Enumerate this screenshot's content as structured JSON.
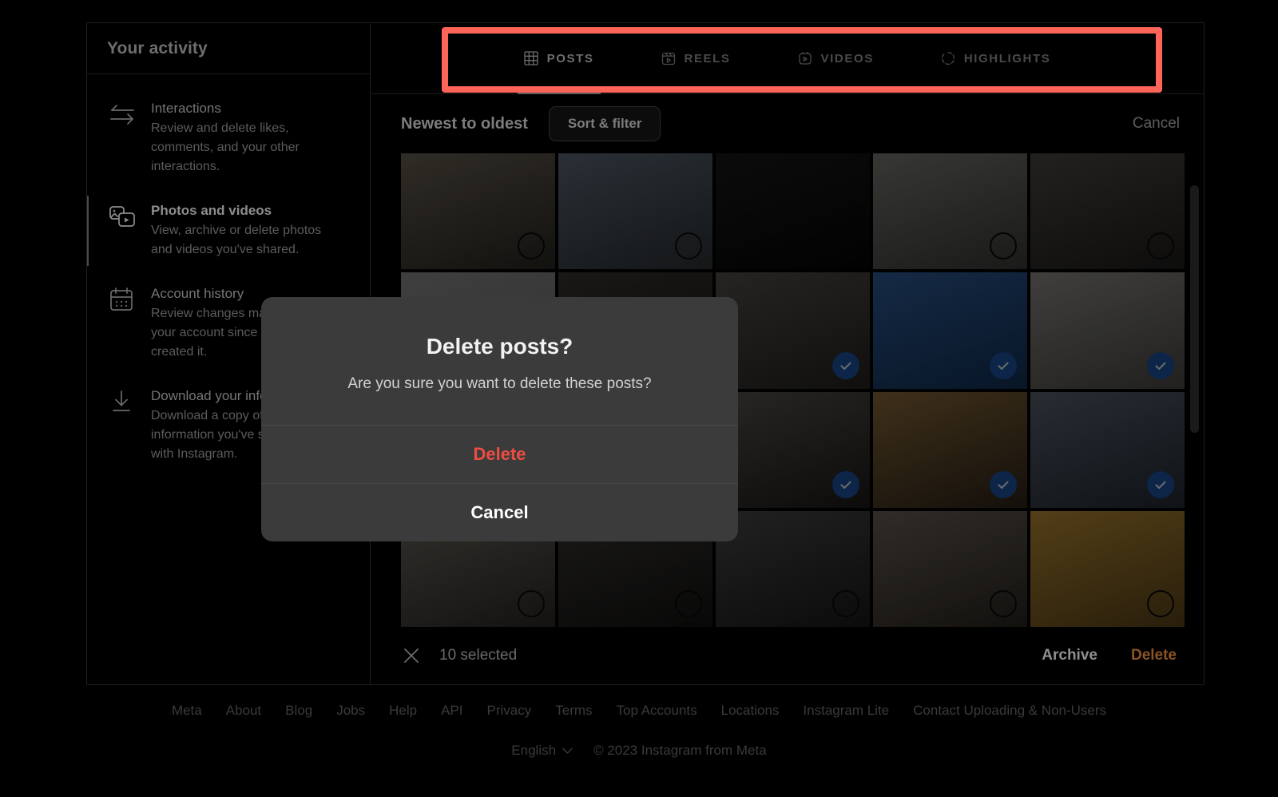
{
  "sidebar": {
    "title": "Your activity",
    "items": [
      {
        "icon": "interactions-arrows-icon",
        "label": "Interactions",
        "desc": "Review and delete likes, comments, and your other interactions.",
        "active": false
      },
      {
        "icon": "photos-videos-icon",
        "label": "Photos and videos",
        "desc": "View, archive or delete photos and videos you've shared.",
        "active": true
      },
      {
        "icon": "calendar-icon",
        "label": "Account history",
        "desc": "Review changes made to your account since you created it.",
        "active": false
      },
      {
        "icon": "download-icon",
        "label": "Download your information",
        "desc": "Download a copy of the information you've shared with Instagram.",
        "active": false
      }
    ]
  },
  "tabs": [
    {
      "label": "POSTS",
      "icon": "grid-icon",
      "active": true
    },
    {
      "label": "REELS",
      "icon": "reels-icon",
      "active": false
    },
    {
      "label": "VIDEOS",
      "icon": "video-icon",
      "active": false
    },
    {
      "label": "HIGHLIGHTS",
      "icon": "highlights-icon",
      "active": false
    }
  ],
  "toolbar": {
    "sort_label": "Newest to oldest",
    "sort_filter_label": "Sort & filter",
    "cancel_label": "Cancel"
  },
  "grid": {
    "tiles": [
      {
        "selected": false,
        "c1": "#6b6356",
        "c2": "#2a2722"
      },
      {
        "selected": false,
        "c1": "#5d6a78",
        "c2": "#2e3236"
      },
      {
        "selected": false,
        "c1": "#1a1a1a",
        "c2": "#050505"
      },
      {
        "selected": false,
        "c1": "#7a7a74",
        "c2": "#3a3a38"
      },
      {
        "selected": false,
        "c1": "#4e4a46",
        "c2": "#1f1d1b"
      },
      {
        "selected": false,
        "c1": "#8c8c8c",
        "c2": "#6d6d6d"
      },
      {
        "selected": false,
        "c1": "#3b3631",
        "c2": "#171512"
      },
      {
        "selected": true,
        "c1": "#55504a",
        "c2": "#252320"
      },
      {
        "selected": true,
        "c1": "#2f5d99",
        "c2": "#123055"
      },
      {
        "selected": true,
        "c1": "#8d8b86",
        "c2": "#4a4845"
      },
      {
        "selected": false,
        "c1": "#8f8f8f",
        "c2": "#7a7a7a"
      },
      {
        "selected": false,
        "c1": "#8f8f8f",
        "c2": "#7a7a7a"
      },
      {
        "selected": true,
        "c1": "#5a5550",
        "c2": "#1c1a18"
      },
      {
        "selected": true,
        "c1": "#8a6a3a",
        "c2": "#2c2318"
      },
      {
        "selected": true,
        "c1": "#5a6472",
        "c2": "#232932"
      },
      {
        "selected": false,
        "c1": "#6e6a62",
        "c2": "#2b2926"
      },
      {
        "selected": false,
        "c1": "#3a3834",
        "c2": "#141312"
      },
      {
        "selected": false,
        "c1": "#4a4a4a",
        "c2": "#1a1a1a"
      },
      {
        "selected": false,
        "c1": "#6a625a",
        "c2": "#2a2520"
      },
      {
        "selected": false,
        "c1": "#b88b34",
        "c2": "#5a4418"
      }
    ]
  },
  "bottombar": {
    "close_icon": "close-icon",
    "selected_text": "10 selected",
    "archive_label": "Archive",
    "delete_label": "Delete"
  },
  "modal": {
    "title": "Delete posts?",
    "subtitle": "Are you sure you want to delete these posts?",
    "delete_label": "Delete",
    "cancel_label": "Cancel"
  },
  "footer": {
    "links": [
      "Meta",
      "About",
      "Blog",
      "Jobs",
      "Help",
      "API",
      "Privacy",
      "Terms",
      "Top Accounts",
      "Locations",
      "Instagram Lite",
      "Contact Uploading & Non-Users"
    ],
    "language": "English",
    "language_chevron_icon": "chevron-down-icon",
    "copyright": "© 2023 Instagram from Meta"
  },
  "annotation": {
    "highlight_color": "#ff6459",
    "target": "tabbar"
  }
}
